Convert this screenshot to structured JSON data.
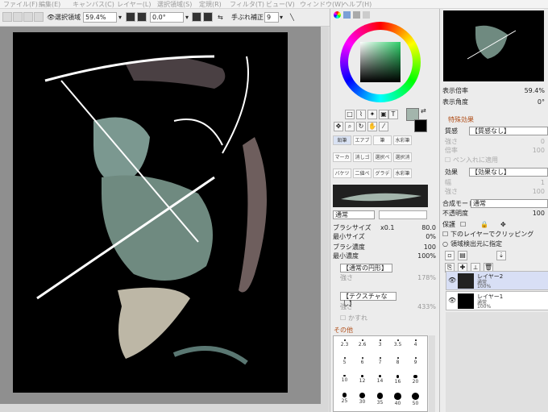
{
  "menu": [
    "ファイル(F)",
    "編集(E)",
    "キャンバス(C)",
    "レイヤー(L)",
    "選択領域(S)",
    "定規(R)",
    "フィルタ(T)",
    "ビュー(V)",
    "ウィンドウ(W)",
    "ヘルプ(H)"
  ],
  "toolbar": {
    "select_area_label": "選択領域",
    "zoom": "59.4%",
    "angle": "0.0°",
    "stabilizer_label": "手ぶれ補正",
    "stabilizer": "9"
  },
  "navigator": {
    "zoom_label": "表示倍率",
    "zoom": "59.4%",
    "angle_label": "表示角度",
    "angle": "0°"
  },
  "special_effects": {
    "header": "特殊効果",
    "texture_label": "質感",
    "texture": "【質感なし】",
    "strength_label": "強さ",
    "strength": "0",
    "magnification_label": "倍率",
    "magnification": "100",
    "apply_pen_label": "ペン入れに適用",
    "effect_label": "効果",
    "effect": "【効果なし】",
    "width_label": "幅",
    "width": "1",
    "strength2_label": "強さ",
    "strength2": "100"
  },
  "layer_props": {
    "blend_label": "合成モード",
    "blend": "通常",
    "opacity_label": "不透明度",
    "opacity": "100",
    "protect_label": "保護",
    "clip_label": "下のレイヤーでクリッピング",
    "source_label": "領域検出元に指定"
  },
  "layers": [
    {
      "name": "レイヤー2",
      "mode": "通常",
      "opacity": "100%"
    },
    {
      "name": "レイヤー1",
      "mode": "通常",
      "opacity": "100%"
    }
  ],
  "tools": {
    "text_icon": "T"
  },
  "brushes": [
    {
      "label": "鉛筆"
    },
    {
      "label": "エアブラシ"
    },
    {
      "label": "筆"
    },
    {
      "label": "水彩筆"
    },
    {
      "label": "マーカー"
    },
    {
      "label": "消しゴム"
    },
    {
      "label": "選択ペン"
    },
    {
      "label": "選択消し"
    },
    {
      "label": "バケツ"
    },
    {
      "label": "二値ペン"
    },
    {
      "label": "グラデー"
    },
    {
      "label": "水彩筆"
    }
  ],
  "brush_settings": {
    "mode": "通常",
    "size_label": "ブラシサイズ",
    "size_mult": "x0.1",
    "size": "80.0",
    "min_size_label": "最小サイズ",
    "min_size": "0%",
    "density_label": "ブラシ濃度",
    "density": "100",
    "min_density_label": "最小濃度",
    "min_density": "100%",
    "shape": "【通常の円形】",
    "shape_strength_label": "強さ",
    "shape_strength": "178%",
    "texture": "【テクスチャなし】",
    "texture_val": "1",
    "texture_strength_label": "強さ",
    "texture_strength": "433%",
    "blur_label": "かすれ",
    "other_label": "その他"
  },
  "dot_sizes": [
    "2.3",
    "2.6",
    "3",
    "3.5",
    "4",
    "5",
    "6",
    "7",
    "8",
    "9",
    "10",
    "12",
    "14",
    "16",
    "20",
    "25",
    "30",
    "35",
    "40",
    "50"
  ],
  "colors": {
    "primary": "#a3b5ac",
    "secondary": "#000000",
    "accent": "#7a9fd6"
  }
}
